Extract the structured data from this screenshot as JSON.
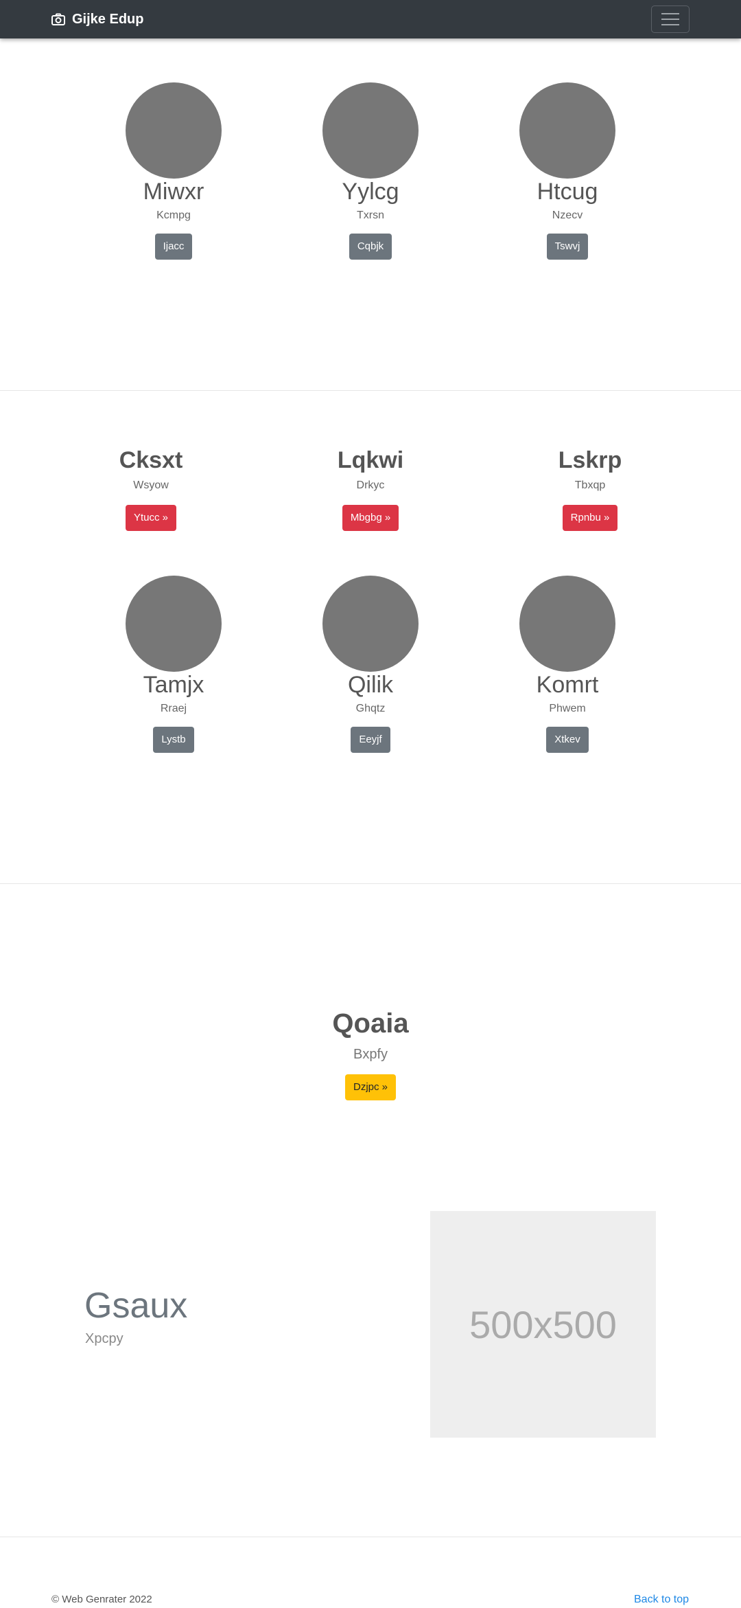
{
  "navbar": {
    "brand": "Gijke Edup",
    "brand_icon": "camera-icon",
    "toggler_icon": "hamburger-icon"
  },
  "row1": [
    {
      "title": "Miwxr",
      "subtitle": "Kcmpg",
      "button": "Ijacc"
    },
    {
      "title": "Yylcg",
      "subtitle": "Txrsn",
      "button": "Cqbjk"
    },
    {
      "title": "Htcug",
      "subtitle": "Nzecv",
      "button": "Tswvj"
    }
  ],
  "row2": [
    {
      "title": "Cksxt",
      "subtitle": "Wsyow",
      "button": "Ytucc »"
    },
    {
      "title": "Lqkwi",
      "subtitle": "Drkyc",
      "button": "Mbgbg »"
    },
    {
      "title": "Lskrp",
      "subtitle": "Tbxqp",
      "button": "Rpnbu »"
    }
  ],
  "row3": [
    {
      "title": "Tamjx",
      "subtitle": "Rraej",
      "button": "Lystb"
    },
    {
      "title": "Qilik",
      "subtitle": "Ghqtz",
      "button": "Eeyjf"
    },
    {
      "title": "Komrt",
      "subtitle": "Phwem",
      "button": "Xtkev"
    }
  ],
  "center": {
    "title": "Qoaia",
    "subtitle": "Bxpfy",
    "button": "Dzjpc »"
  },
  "feature": {
    "title": "Gsaux",
    "subtitle": "Xpcpy",
    "image_label": "500x500"
  },
  "footer": {
    "copyright": "© Web Genrater 2022",
    "back_to_top": "Back to top"
  },
  "colors": {
    "navbar": "#343a40",
    "circle": "#777777",
    "red": "#dc3545",
    "gray": "#6c757d",
    "yellow": "#ffc107",
    "link": "#1e88e5"
  }
}
